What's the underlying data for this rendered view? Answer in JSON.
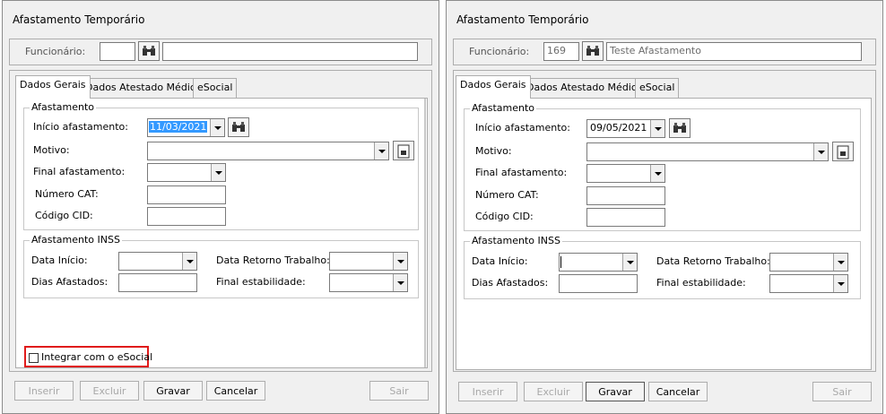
{
  "windows": [
    {
      "title": "Afastamento Temporário",
      "funcionario_label": "Funcionário:",
      "funcionario_code": "",
      "funcionario_name": "",
      "tabs": [
        "Dados Gerais",
        "Dados Atestado Médico",
        "eSocial"
      ],
      "group_afastamento": "Afastamento",
      "inicio_label": "Início afastamento:",
      "inicio_value": "11/03/2021",
      "motivo_label": "Motivo:",
      "motivo_value": "",
      "final_label": "Final afastamento:",
      "final_value": "",
      "cat_label": "Número CAT:",
      "cat_value": "",
      "cid_label": "Código CID:",
      "cid_value": "",
      "group_inss": "Afastamento INSS",
      "data_inicio_label": "Data Início:",
      "data_inicio_value": "",
      "retorno_label": "Data Retorno Trabalho:",
      "retorno_value": "",
      "dias_label": "Dias Afastados:",
      "dias_value": "",
      "estab_label": "Final estabilidade:",
      "estab_value": "",
      "esocial_checkbox_label": "Integrar com o eSocial",
      "esocial_checked": false,
      "buttons": {
        "inserir": "Inserir",
        "excluir": "Excluir",
        "gravar": "Gravar",
        "cancelar": "Cancelar",
        "sair": "Sair"
      }
    },
    {
      "title": "Afastamento Temporário",
      "funcionario_label": "Funcionário:",
      "funcionario_code": "169",
      "funcionario_name": "Teste Afastamento",
      "tabs": [
        "Dados Gerais",
        "Dados Atestado Médico",
        "eSocial"
      ],
      "group_afastamento": "Afastamento",
      "inicio_label": "Início afastamento:",
      "inicio_value": "09/05/2021",
      "motivo_label": "Motivo:",
      "motivo_value": "",
      "final_label": "Final afastamento:",
      "final_value": "",
      "cat_label": "Número CAT:",
      "cat_value": "",
      "cid_label": "Código CID:",
      "cid_value": "",
      "group_inss": "Afastamento INSS",
      "data_inicio_label": "Data Início:",
      "data_inicio_value": "",
      "retorno_label": "Data Retorno Trabalho:",
      "retorno_value": "",
      "dias_label": "Dias Afastados:",
      "dias_value": "",
      "estab_label": "Final estabilidade:",
      "estab_value": "",
      "buttons": {
        "inserir": "Inserir",
        "excluir": "Excluir",
        "gravar": "Gravar",
        "cancelar": "Cancelar",
        "sair": "Sair"
      }
    }
  ],
  "colors": {
    "highlight_border": "#e01b1b",
    "selection": "#3399ff",
    "window_bg": "#f0f0f0"
  },
  "icons": {
    "search": "binoculars-icon",
    "motivo_detail": "document-icon",
    "dropdown": "chevron-down-icon"
  }
}
